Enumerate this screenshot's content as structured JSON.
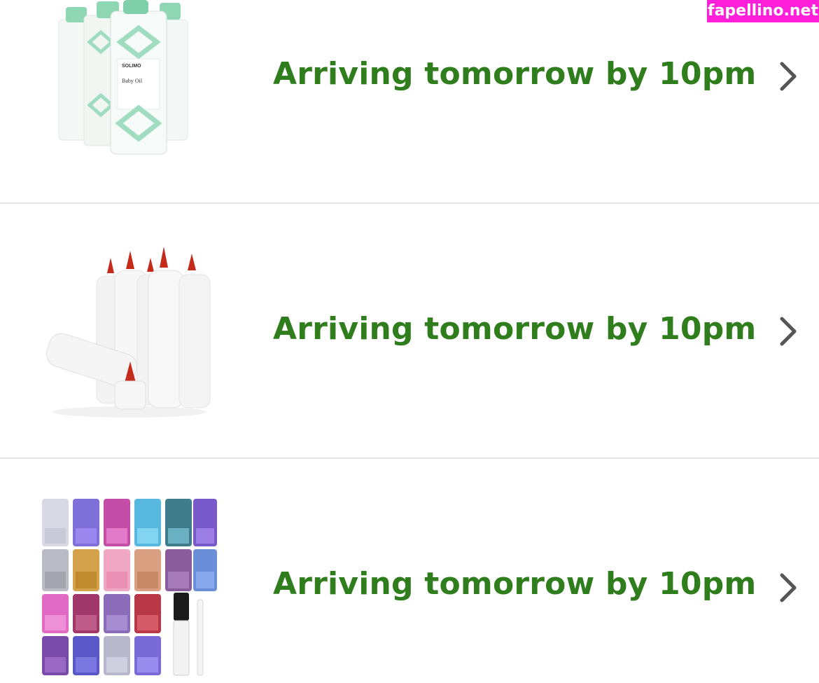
{
  "watermark": "fapellino.net",
  "orders": [
    {
      "status": "Arriving tomorrow by 10pm",
      "product_image": "baby-oil-bottles",
      "brand": "SOLIMO",
      "product_label": "Baby Oil"
    },
    {
      "status": "Arriving tomorrow by 10pm",
      "product_image": "squeeze-bottles"
    },
    {
      "status": "Arriving tomorrow by 10pm",
      "product_image": "glitter-jars-set"
    }
  ],
  "colors": {
    "status_green": "#2f7d1c",
    "chevron": "#555555",
    "divider": "#e3e3e3",
    "watermark_bg": "#ff1fd8"
  },
  "icons": {
    "row_action": "chevron-right-icon"
  }
}
